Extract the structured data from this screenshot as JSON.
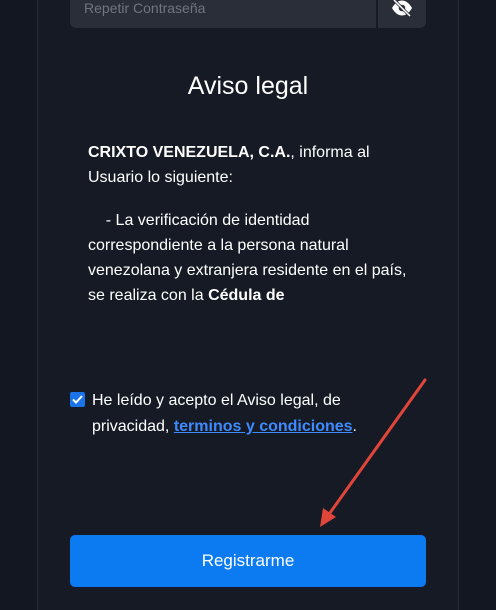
{
  "password_repeat": {
    "placeholder": "Repetir Contraseña",
    "toggle_icon": "eye-slash-icon"
  },
  "notice": {
    "title": "Aviso legal",
    "company": "CRIXTO VENEZUELA, C.A.",
    "intro_rest": ", informa al Usuario lo siguiente:",
    "point_text": "- La verificación de identidad correspondiente a la persona natural venezolana y extranjera residente en el país, se realiza con la ",
    "point_bold": "Cédula de"
  },
  "acceptance": {
    "checked": true,
    "text": "He leído y acepto el Aviso legal, de privacidad, ",
    "link_label": "terminos y condiciones",
    "suffix": "."
  },
  "register_button": {
    "label": "Registrarme"
  },
  "colors": {
    "background": "#131722",
    "input": "#2a2e39",
    "accent": "#0c7bf2",
    "link": "#3d8bff",
    "annotation_arrow": "#e0453a"
  }
}
